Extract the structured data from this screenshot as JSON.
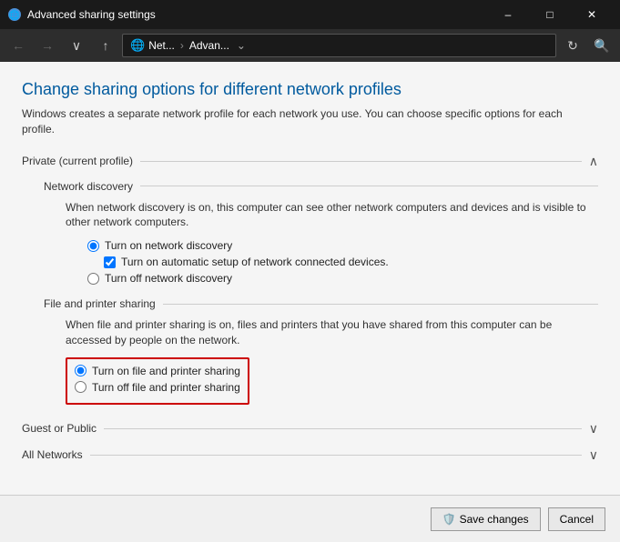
{
  "titleBar": {
    "title": "Advanced sharing settings",
    "minLabel": "–",
    "maxLabel": "□",
    "closeLabel": "✕"
  },
  "addressBar": {
    "backLabel": "←",
    "forwardLabel": "→",
    "downLabel": "∨",
    "upLabel": "↑",
    "addressPart1": "Net...",
    "addressPart2": "Advan...",
    "dropdownLabel": "⌄",
    "refreshLabel": "↻",
    "searchLabel": "🔍"
  },
  "page": {
    "title": "Change sharing options for different network profiles",
    "subtitle": "Windows creates a separate network profile for each network you use. You can choose specific options for each profile."
  },
  "sections": {
    "privateSection": {
      "label": "Private (current profile)",
      "chevron": "∧",
      "networkDiscovery": {
        "label": "Network discovery",
        "description": "When network discovery is on, this computer can see other network computers and devices and is visible to other network computers.",
        "option1": "Turn on network discovery",
        "option1Checked": true,
        "subOption": "Turn on automatic setup of network connected devices.",
        "subOptionChecked": true,
        "option2": "Turn off network discovery",
        "option2Checked": false
      },
      "fileAndPrinter": {
        "label": "File and printer sharing",
        "description": "When file and printer sharing is on, files and printers that you have shared from this computer can be accessed by people on the network.",
        "option1": "Turn on file and printer sharing",
        "option1Checked": true,
        "option2": "Turn off file and printer sharing",
        "option2Checked": false
      }
    },
    "guestSection": {
      "label": "Guest or Public",
      "chevron": "∨"
    },
    "allNetworksSection": {
      "label": "All Networks",
      "chevron": "∨"
    }
  },
  "footer": {
    "saveLabel": "Save changes",
    "cancelLabel": "Cancel"
  }
}
